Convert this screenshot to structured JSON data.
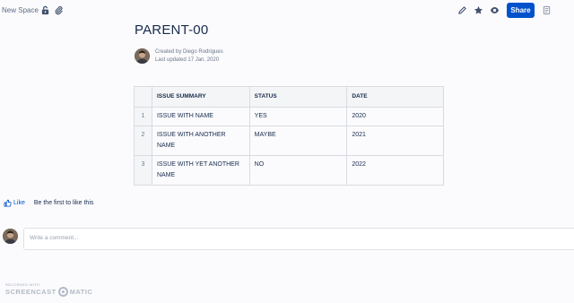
{
  "topbar": {
    "space_name": "New Space",
    "icons": [
      "unlock-icon",
      "attachment-icon",
      "edit-icon",
      "star-icon",
      "watch-icon",
      "page-tree-icon"
    ],
    "share_label": "Share",
    "brand_color": "#0052cc"
  },
  "page": {
    "title": "PARENT-00",
    "created_by": "Created by Diego Rodrigues",
    "last_updated": "Last updated 17 Jan, 2020"
  },
  "table": {
    "headers": [
      "",
      "ISSUE SUMMARY",
      "STATUS",
      "DATE"
    ],
    "rows": [
      {
        "num": "1",
        "summary": "ISSUE WITH NAME",
        "status": "YES",
        "date": "2020"
      },
      {
        "num": "2",
        "summary": "ISSUE WITH ANOTHER NAME",
        "status": "MAYBE",
        "date": "2021"
      },
      {
        "num": "3",
        "summary": "ISSUE WITH YET ANOTHER NAME",
        "status": "NO",
        "date": "2022"
      }
    ]
  },
  "likes": {
    "like_label": "Like",
    "hint": "Be the first to like this"
  },
  "comment": {
    "placeholder": "Write a comment..."
  },
  "watermark": {
    "top": "RECORDED WITH",
    "left": "SCREENCAST",
    "right": "MATIC"
  }
}
